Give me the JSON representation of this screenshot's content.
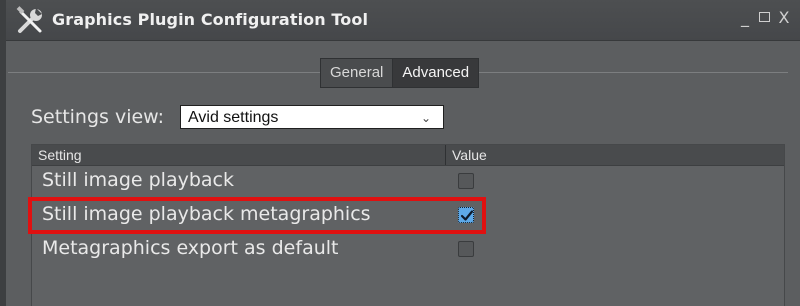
{
  "window": {
    "title": "Graphics Plugin Configuration Tool",
    "controls": [
      "minimize",
      "maximize",
      "close"
    ],
    "close_glyph": "X",
    "minimize_glyph": "_"
  },
  "tabs": [
    {
      "label": "General",
      "selected": false
    },
    {
      "label": "Advanced",
      "selected": true
    }
  ],
  "settings_view": {
    "label": "Settings view:",
    "selected_value": "Avid settings"
  },
  "table": {
    "columns": [
      "Setting",
      "Value"
    ],
    "rows": [
      {
        "label": "Still image playback",
        "checked": false
      },
      {
        "label": "Still image playback metagraphics",
        "checked": true,
        "highlighted": true
      },
      {
        "label": "Metagraphics export as default",
        "checked": false
      }
    ]
  },
  "colors": {
    "highlight_border": "#e01010",
    "checkbox_checked": "#5da9e9",
    "window_bg": "#5c5e60"
  },
  "icons": {
    "app": "tools-icon",
    "dropdown": "chevron-down-icon",
    "check": "checkmark-icon"
  }
}
